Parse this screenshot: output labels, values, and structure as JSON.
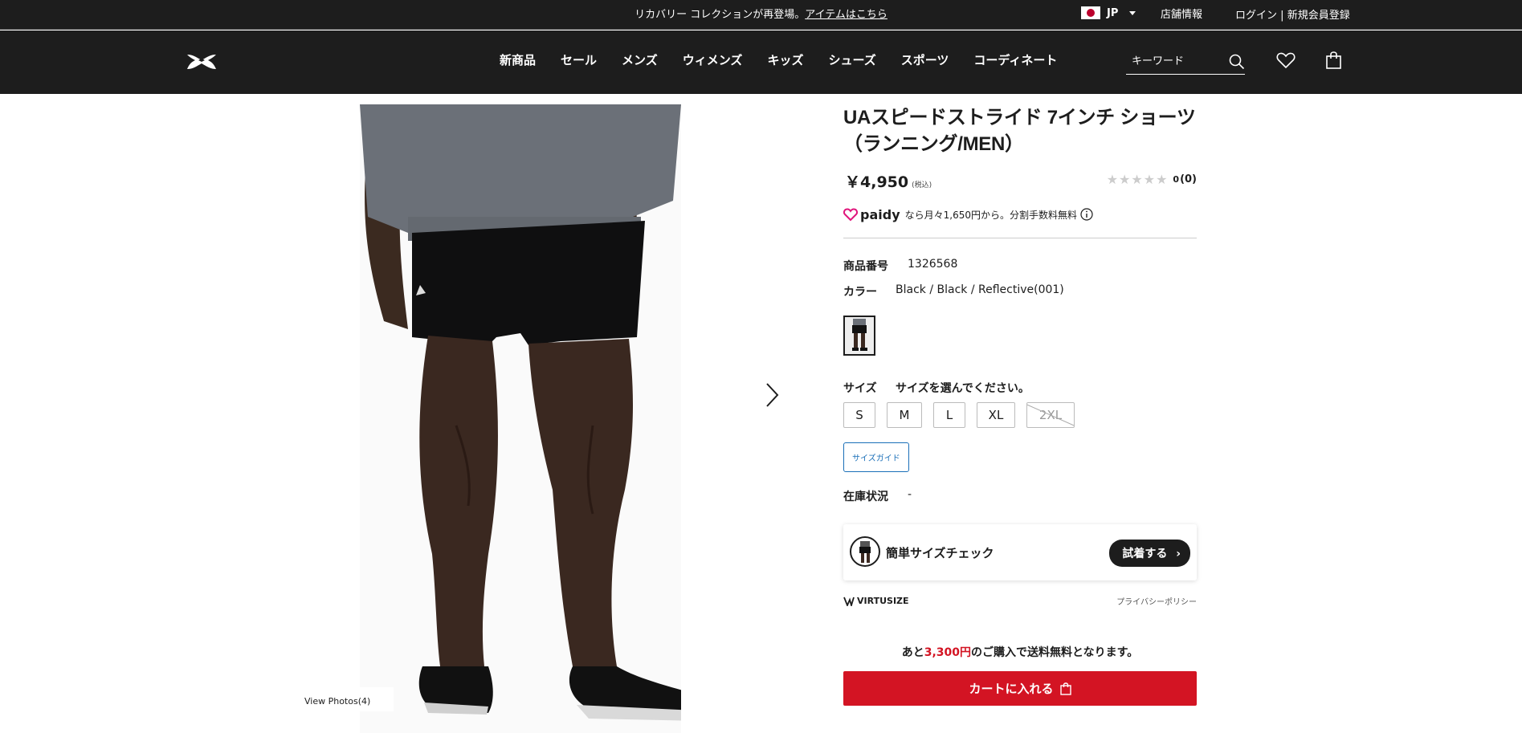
{
  "topbar": {
    "announcement": "リカバリー コレクションが再登場。",
    "announcement_link": "アイテムはこちら",
    "locale": "JP",
    "store_info": "店舗情報",
    "login": "ログイン",
    "separator": "|",
    "register": "新規会員登録"
  },
  "header": {
    "nav": [
      "新商品",
      "セール",
      "メンズ",
      "ウィメンズ",
      "キッズ",
      "シューズ",
      "スポーツ",
      "コーディネート"
    ],
    "search_placeholder": "キーワード"
  },
  "gallery": {
    "view_photos": "View Photos(4)"
  },
  "product": {
    "title_line1": "UAスピードストライド 7インチ ショーツ",
    "title_line2": "（ランニング/MEN）",
    "price": "￥4,950",
    "tax_note": "(税込)",
    "rating_value": "0",
    "rating_count": "(0)",
    "paidy_brand": "paidy",
    "paidy_text": "なら月々1,650円から。分割手数料無料",
    "sku_label": "商品番号",
    "sku_value": "1326568",
    "color_label": "カラー",
    "color_value": "Black / Black / Reflective(001)",
    "size_label": "サイズ",
    "size_prompt": "サイズを選んでください。",
    "sizes": [
      {
        "label": "S",
        "available": true
      },
      {
        "label": "M",
        "available": true
      },
      {
        "label": "L",
        "available": true
      },
      {
        "label": "XL",
        "available": true
      },
      {
        "label": "2XL",
        "available": false
      }
    ],
    "size_guide": "サイズガイド",
    "stock_label": "在庫状況",
    "stock_value": "-"
  },
  "virtusize": {
    "label": "簡単サイズチェック",
    "button": "試着する",
    "brand": "VIRTUSIZE",
    "policy": "プライバシーポリシー"
  },
  "shipping": {
    "prefix": "あと",
    "amount": "3,300円",
    "suffix": "のご購入で送料無料となります。"
  },
  "cart": {
    "button": "カートに入れる"
  }
}
